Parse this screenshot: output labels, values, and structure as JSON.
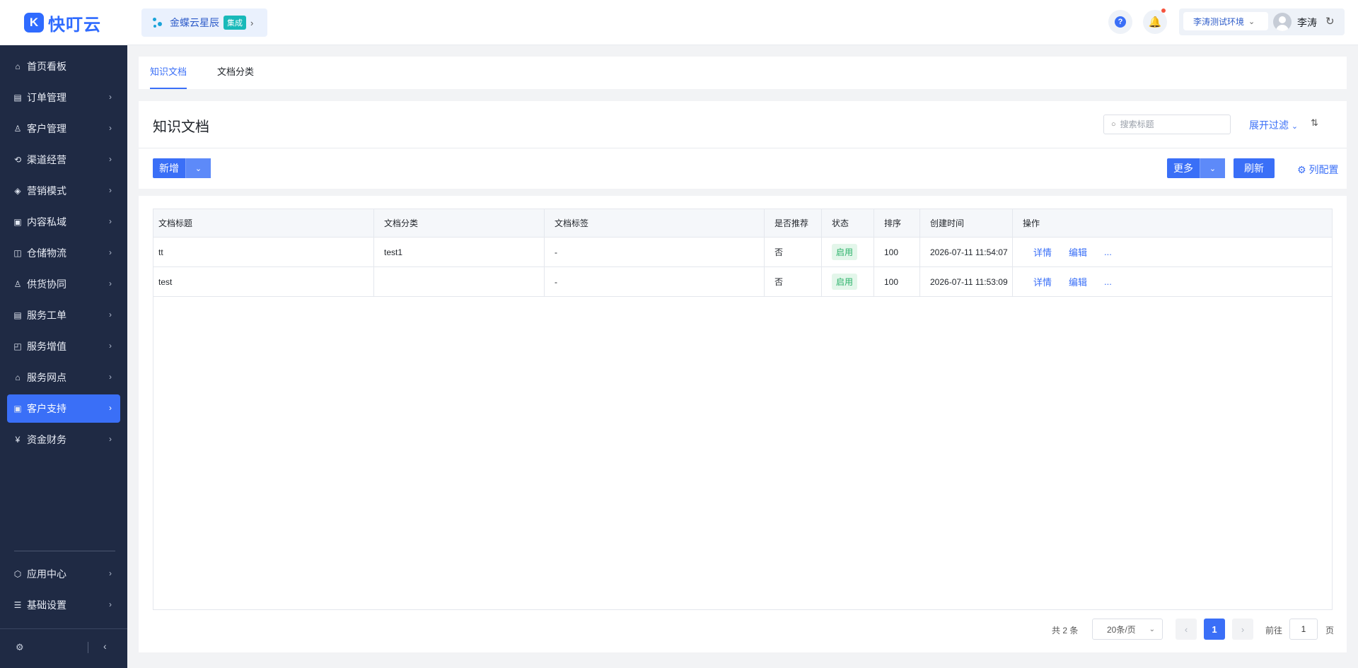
{
  "brand": {
    "logo_letter": "K",
    "name": "快叮云"
  },
  "topbar": {
    "app_chip": {
      "name": "金蝶云星辰",
      "badge": "集成"
    },
    "help_icon": "?",
    "environment": "李涛测试环境",
    "user_name": "李涛"
  },
  "sidebar": {
    "items": [
      {
        "label": "首页看板",
        "icon": "⌂"
      },
      {
        "label": "订单管理",
        "icon": "▤"
      },
      {
        "label": "客户管理",
        "icon": "♙"
      },
      {
        "label": "渠道经营",
        "icon": "⟲"
      },
      {
        "label": "营销模式",
        "icon": "◈"
      },
      {
        "label": "内容私域",
        "icon": "▣"
      },
      {
        "label": "仓储物流",
        "icon": "◫"
      },
      {
        "label": "供货协同",
        "icon": "♙"
      },
      {
        "label": "服务工单",
        "icon": "▤"
      },
      {
        "label": "服务增值",
        "icon": "◰"
      },
      {
        "label": "服务网点",
        "icon": "⌂"
      },
      {
        "label": "客户支持",
        "icon": "▣",
        "active": true
      },
      {
        "label": "资金财务",
        "icon": "¥"
      }
    ],
    "bottom_items": [
      {
        "label": "应用中心",
        "icon": "⬡"
      },
      {
        "label": "基础设置",
        "icon": "☰"
      }
    ]
  },
  "tabs": [
    {
      "label": "知识文档",
      "active": true
    },
    {
      "label": "文档分类"
    }
  ],
  "page": {
    "title": "知识文档",
    "search_placeholder": "搜索标题",
    "expand_filter": "展开过滤",
    "add_button": "新增",
    "more_button": "更多",
    "refresh_button": "刷新",
    "column_config": "列配置"
  },
  "table": {
    "columns": [
      "文档标题",
      "文档分类",
      "文档标签",
      "是否推荐",
      "状态",
      "排序",
      "创建时间",
      "操作"
    ],
    "rows": [
      {
        "title": "tt",
        "category": "test1",
        "tags": "-",
        "recommended": "否",
        "status": "启用",
        "sort": "100",
        "created": "2026-07-11 11:54:07"
      },
      {
        "title": "test",
        "category": "",
        "tags": "-",
        "recommended": "否",
        "status": "启用",
        "sort": "100",
        "created": "2026-07-11 11:53:09"
      }
    ],
    "actions": {
      "detail": "详情",
      "edit": "编辑",
      "more": "..."
    }
  },
  "pagination": {
    "total": "共 2 条",
    "page_size": "20条/页",
    "current_page": "1",
    "goto_label": "前往",
    "goto_value": "1",
    "page_unit": "页"
  },
  "colors": {
    "primary": "#3a6ff7",
    "sidebar_bg": "#1f2a44",
    "status_green": "#2bb26a"
  }
}
